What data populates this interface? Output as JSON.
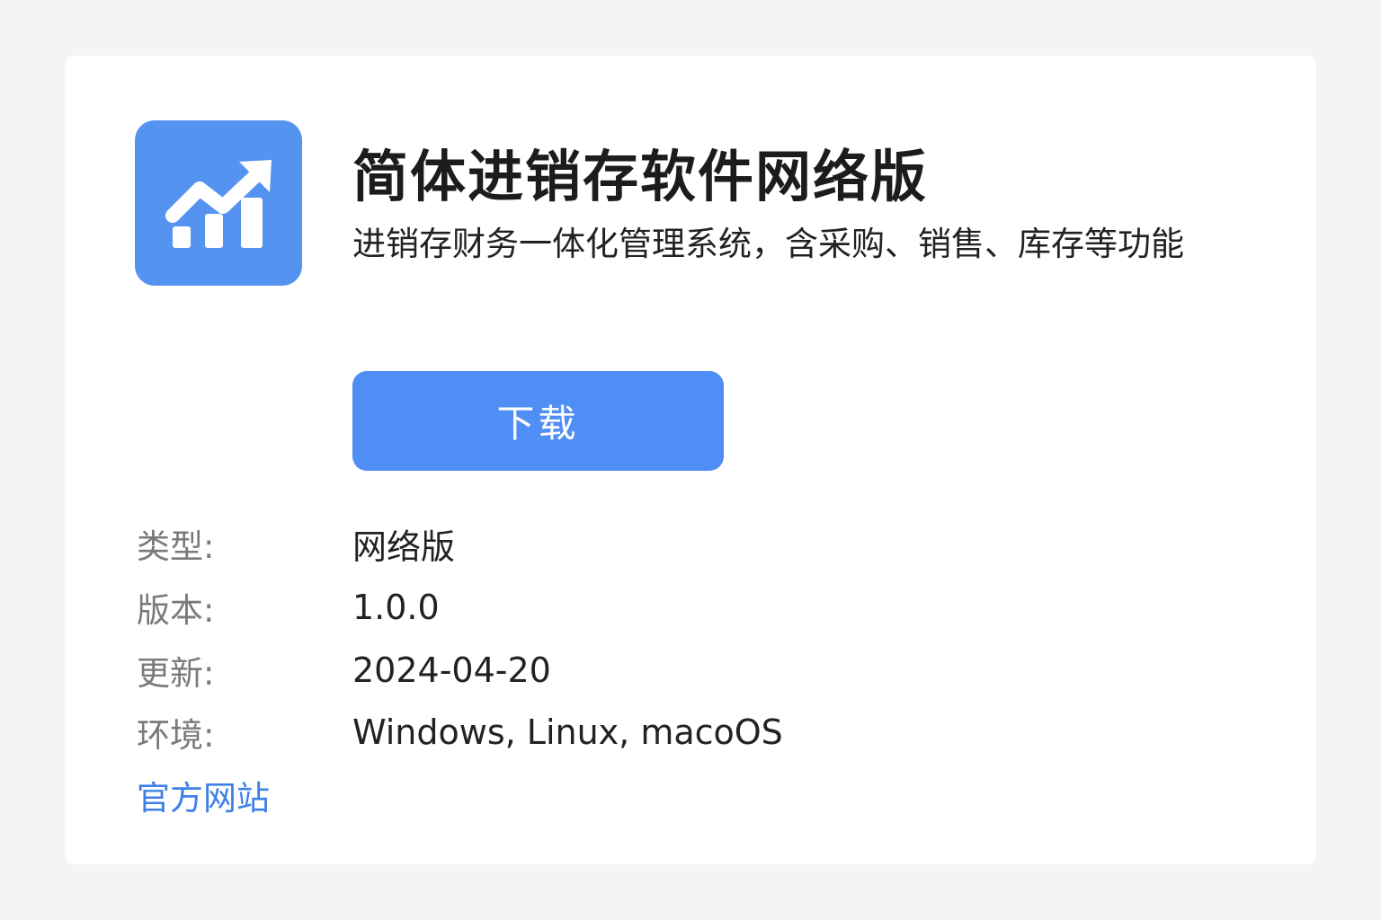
{
  "app": {
    "icon": "trending-chart-icon",
    "title": "简体进销存软件网络版",
    "description": "进销存财务一体化管理系统，含采购、销售、库存等功能"
  },
  "actions": {
    "download_label": "下载"
  },
  "info": [
    {
      "label": "类型:",
      "value": "网络版"
    },
    {
      "label": "版本:",
      "value": "1.0.0"
    },
    {
      "label": "更新:",
      "value": "2024-04-20"
    },
    {
      "label": "环境:",
      "value": "Windows, Linux, macoOS"
    }
  ],
  "links": {
    "official_site": "官方网站"
  },
  "colors": {
    "accent": "#4f8ef4",
    "icon_bg": "#5593f1",
    "link": "#3f80e8"
  }
}
